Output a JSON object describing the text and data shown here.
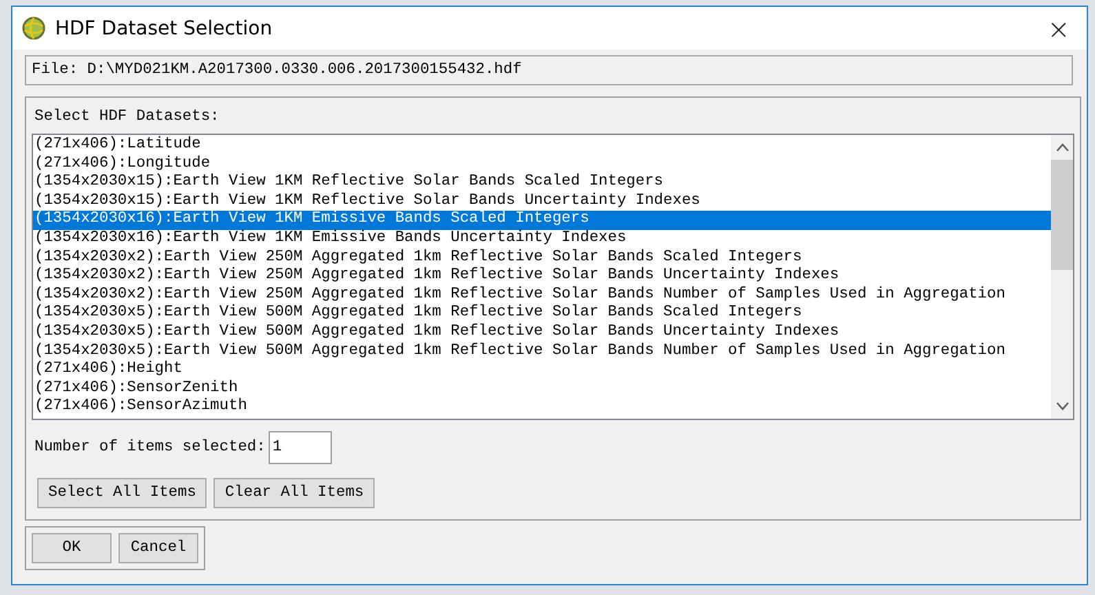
{
  "window": {
    "title": "HDF Dataset Selection",
    "close": "×"
  },
  "file_field": {
    "value": "File: D:\\MYD021KM.A2017300.0330.006.2017300155432.hdf"
  },
  "datasets": {
    "label": "Select HDF Datasets:",
    "items": [
      {
        "text": "(271x406):Latitude",
        "selected": false
      },
      {
        "text": "(271x406):Longitude",
        "selected": false
      },
      {
        "text": "(1354x2030x15):Earth View 1KM Reflective Solar Bands Scaled Integers",
        "selected": false
      },
      {
        "text": "(1354x2030x15):Earth View 1KM Reflective Solar Bands Uncertainty Indexes",
        "selected": false
      },
      {
        "text": "(1354x2030x16):Earth View 1KM Emissive Bands Scaled Integers",
        "selected": true
      },
      {
        "text": "(1354x2030x16):Earth View 1KM Emissive Bands Uncertainty Indexes",
        "selected": false
      },
      {
        "text": "(1354x2030x2):Earth View 250M Aggregated 1km Reflective Solar Bands Scaled Integers",
        "selected": false
      },
      {
        "text": "(1354x2030x2):Earth View 250M Aggregated 1km Reflective Solar Bands Uncertainty Indexes",
        "selected": false
      },
      {
        "text": "(1354x2030x2):Earth View 250M Aggregated 1km Reflective Solar Bands Number of Samples Used in Aggregation",
        "selected": false
      },
      {
        "text": "(1354x2030x5):Earth View 500M Aggregated 1km Reflective Solar Bands Scaled Integers",
        "selected": false
      },
      {
        "text": "(1354x2030x5):Earth View 500M Aggregated 1km Reflective Solar Bands Uncertainty Indexes",
        "selected": false
      },
      {
        "text": "(1354x2030x5):Earth View 500M Aggregated 1km Reflective Solar Bands Number of Samples Used in Aggregation",
        "selected": false
      },
      {
        "text": "(271x406):Height",
        "selected": false
      },
      {
        "text": "(271x406):SensorZenith",
        "selected": false
      },
      {
        "text": "(271x406):SensorAzimuth",
        "selected": false
      }
    ]
  },
  "count": {
    "label": "Number of items selected:",
    "value": "1"
  },
  "list_buttons": [
    "Select All Items",
    "Clear All Items"
  ],
  "dialog_buttons": [
    "OK",
    "Cancel"
  ]
}
